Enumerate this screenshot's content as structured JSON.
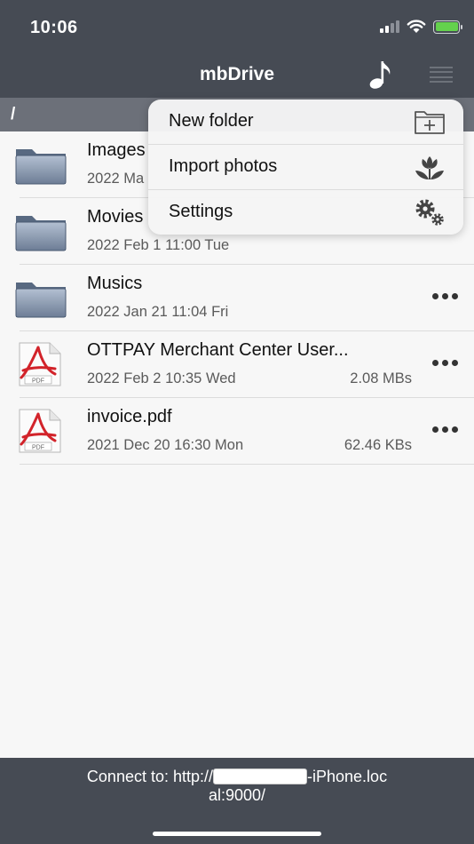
{
  "status": {
    "time": "10:06"
  },
  "nav": {
    "title": "mbDrive",
    "music_icon": "music-note-icon",
    "menu_icon": "menu-icon"
  },
  "path": "/",
  "menu": [
    {
      "label": "New folder",
      "icon": "new-folder-icon"
    },
    {
      "label": "Import photos",
      "icon": "flower-icon"
    },
    {
      "label": "Settings",
      "icon": "gears-icon"
    }
  ],
  "files": [
    {
      "name": "Images",
      "date": "2022 Ma",
      "size": "",
      "kind": "folder"
    },
    {
      "name": "Movies",
      "date": "2022 Feb 1  11:00 Tue",
      "size": "",
      "kind": "folder"
    },
    {
      "name": "Musics",
      "date": "2022 Jan 21  11:04 Fri",
      "size": "",
      "kind": "folder"
    },
    {
      "name": "OTTPAY Merchant Center User...",
      "date": "2022 Feb 2  10:35 Wed",
      "size": "2.08 MBs",
      "kind": "pdf"
    },
    {
      "name": "invoice.pdf",
      "date": "2021 Dec 20  16:30 Mon",
      "size": "62.46 KBs",
      "kind": "pdf"
    }
  ],
  "footer": {
    "prefix": "Connect to: http://",
    "suffix_line1": "-iPhone.loc",
    "line2": "al:9000/"
  },
  "colors": {
    "bar": "#464b54",
    "pathbar": "#6c7079",
    "battery": "#64d14d"
  }
}
